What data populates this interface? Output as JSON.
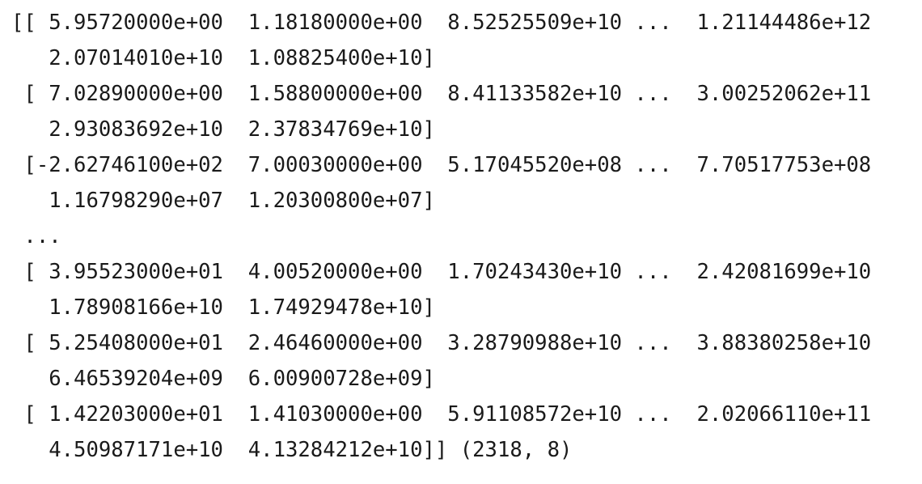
{
  "output": {
    "lines": [
      "[[ 5.95720000e+00  1.18180000e+00  8.52525509e+10 ...  1.21144486e+12",
      "   2.07014010e+10  1.08825400e+10]",
      " [ 7.02890000e+00  1.58800000e+00  8.41133582e+10 ...  3.00252062e+11",
      "   2.93083692e+10  2.37834769e+10]",
      " [-2.62746100e+02  7.00030000e+00  5.17045520e+08 ...  7.70517753e+08",
      "   1.16798290e+07  1.20300800e+07]",
      " ...",
      " [ 3.95523000e+01  4.00520000e+00  1.70243430e+10 ...  2.42081699e+10",
      "   1.78908166e+10  1.74929478e+10]",
      " [ 5.25408000e+01  2.46460000e+00  3.28790988e+10 ...  3.88380258e+10",
      "   6.46539204e+09  6.00900728e+09]",
      " [ 1.42203000e+01  1.41030000e+00  5.91108572e+10 ...  2.02066110e+11",
      "   4.50987171e+10  4.13284212e+10]] (2318, 8)"
    ]
  }
}
